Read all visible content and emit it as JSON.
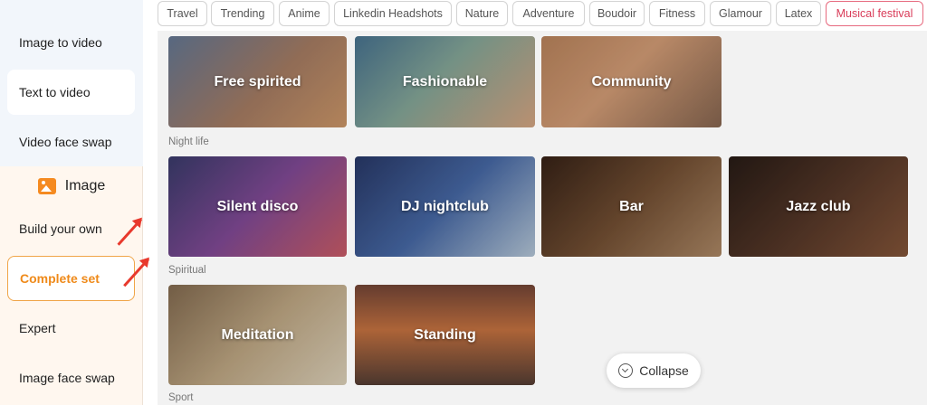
{
  "sidebar": {
    "items": [
      {
        "label": "Image to video"
      },
      {
        "label": "Text to video"
      },
      {
        "label": "Video face swap"
      },
      {
        "label": "Build your own"
      },
      {
        "label": "Complete set"
      },
      {
        "label": "Expert"
      },
      {
        "label": "Image face swap"
      }
    ],
    "section_header": "Image"
  },
  "tags": [
    "Travel",
    "Trending",
    "Anime",
    "Linkedin Headshots",
    "Nature",
    "Adventure",
    "Boudoir",
    "Fitness",
    "Glamour",
    "Latex",
    "Musical festival"
  ],
  "active_tag": "Musical festival",
  "sections": {
    "top": {
      "cards": [
        "Free spirited",
        "Fashionable",
        "Community"
      ]
    },
    "night_life": {
      "label": "Night life",
      "cards": [
        "Silent disco",
        "DJ nightclub",
        "Bar",
        "Jazz club"
      ]
    },
    "spiritual": {
      "label": "Spiritual",
      "cards": [
        "Meditation",
        "Standing"
      ]
    },
    "sport": {
      "label": "Sport"
    }
  },
  "collapse": {
    "label": "Collapse",
    "icon": "chevron-down-circle-icon"
  },
  "colors": {
    "accent": "#ef8a1a",
    "tag_active": "#d93c59",
    "arrow": "#e8392d"
  }
}
